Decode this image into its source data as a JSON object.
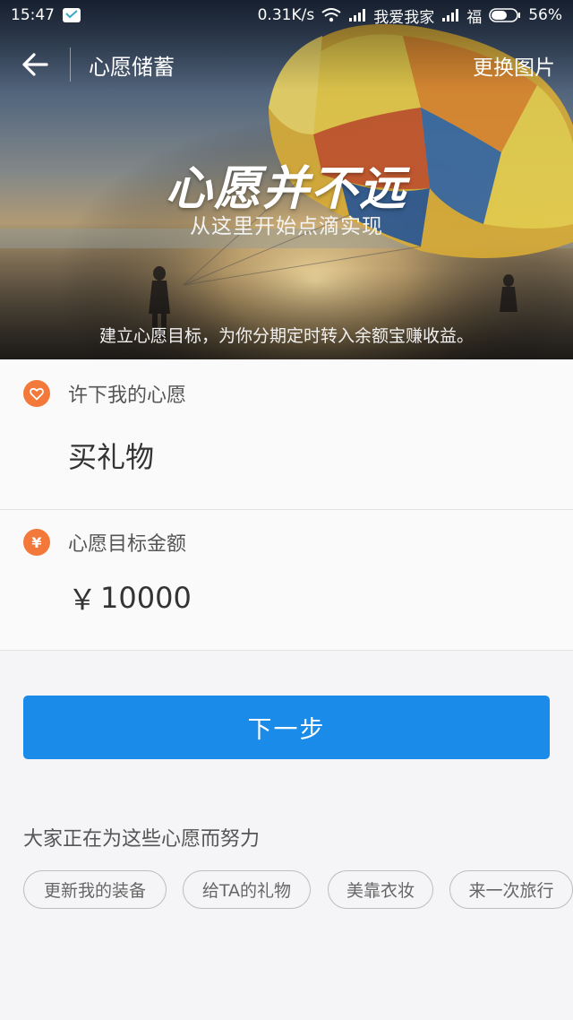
{
  "status_bar": {
    "time": "15:47",
    "network_speed": "0.31K/s",
    "carrier_1": "我爱我家",
    "carrier_2": "福",
    "battery": "56%"
  },
  "header": {
    "title": "心愿储蓄",
    "change_image": "更换图片"
  },
  "hero": {
    "slogan": "心愿并不远",
    "subtitle": "从这里开始点滴实现",
    "caption": "建立心愿目标，为你分期定时转入余额宝赚收益。"
  },
  "wish": {
    "label": "许下我的心愿",
    "value": "买礼物"
  },
  "amount": {
    "label": "心愿目标金额",
    "currency": "￥",
    "value": "10000"
  },
  "next_button": "下一步",
  "suggestions": {
    "title": "大家正在为这些心愿而努力",
    "tags": [
      "更新我的装备",
      "给TA的礼物",
      "美靠衣妆",
      "来一次旅行"
    ]
  },
  "colors": {
    "accent_blue": "#1a8be8",
    "accent_orange": "#f3793b"
  }
}
